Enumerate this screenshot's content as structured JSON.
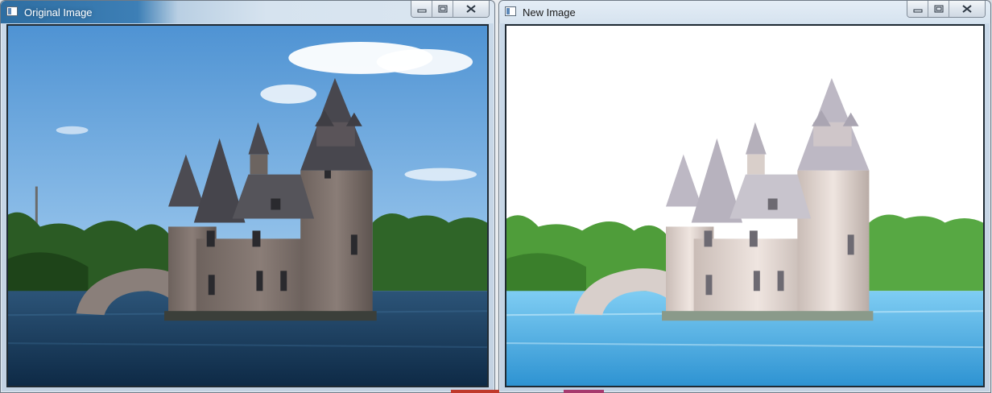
{
  "windows": [
    {
      "title": "Original Image",
      "icon": "app-window-icon",
      "controls": [
        "minimize",
        "maximize",
        "close"
      ]
    },
    {
      "title": "New Image",
      "icon": "app-window-icon",
      "controls": [
        "minimize",
        "maximize",
        "close"
      ]
    }
  ],
  "colors": {
    "sky_original": "#5b9bd5",
    "water_original": "#163b5e",
    "sky_new": "#ffffff",
    "water_new": "#4fb1e6",
    "stone": "#7b6f6a",
    "roof": "#4c4b52",
    "trees": "#2b5b24"
  }
}
